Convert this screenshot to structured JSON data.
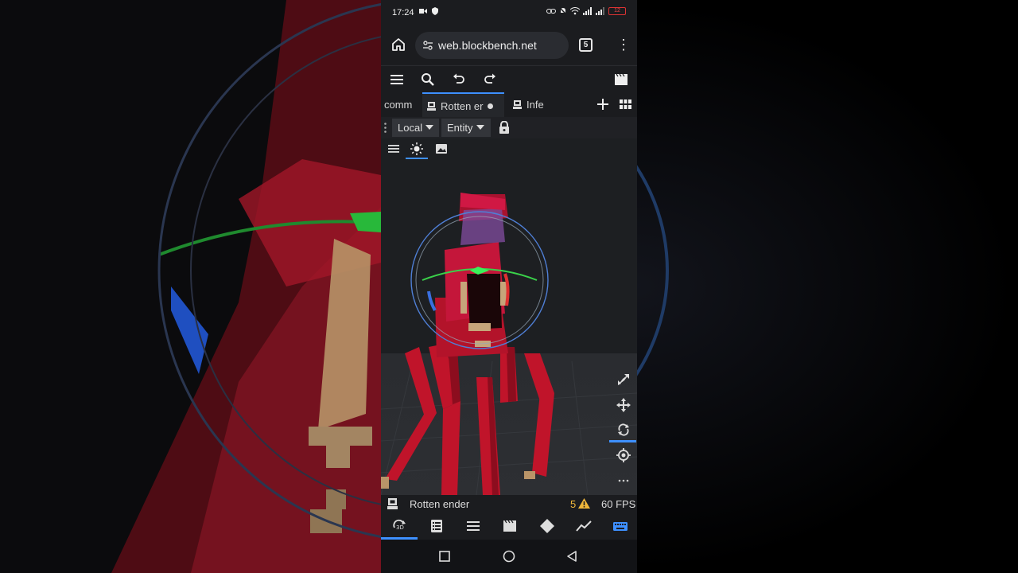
{
  "statusbar": {
    "time": "17:24",
    "battery": "12"
  },
  "browser": {
    "url": "web.blockbench.net",
    "tab_count": "5"
  },
  "app_tabs": [
    {
      "label": "comm"
    },
    {
      "label": "Rotten er"
    },
    {
      "label": "Infe"
    }
  ],
  "modebar": {
    "space_select": "Local",
    "pivot_select": "Entity"
  },
  "status": {
    "project_name": "Rotten ender",
    "warning_count": "5",
    "fps": "60 FPS"
  },
  "colors": {
    "accent": "#3e90ff",
    "warning": "#f0b73a",
    "model_red": "#c0142a"
  }
}
